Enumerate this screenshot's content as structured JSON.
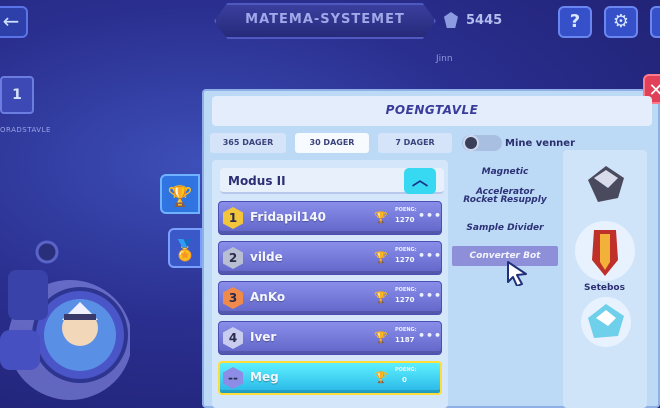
{
  "header": {
    "title": "MATEMA-SYSTEMET",
    "currency_value": "5445",
    "currency_icon": "gem-icon",
    "help_label": "?",
    "location_label": "Jinn"
  },
  "left": {
    "level_value": "1",
    "level_caption": "ORADSTAVLE"
  },
  "modal": {
    "title": "POENGTAVLE",
    "filters": [
      {
        "label": "365 DAGER",
        "active": false
      },
      {
        "label": "30 DAGER",
        "active": true
      },
      {
        "label": "7 DAGER",
        "active": false
      }
    ],
    "friends_toggle_label": "Mine venner",
    "friends_toggle_on": false,
    "mode_label": "Modus II"
  },
  "leaderboard": {
    "points_label": "POENG:",
    "rows": [
      {
        "rank": "1",
        "name": "Fridapil140",
        "points": "1270",
        "rank_color": "#f3c53a"
      },
      {
        "rank": "2",
        "name": "vilde",
        "points": "1270",
        "rank_color": "#b9bfd3"
      },
      {
        "rank": "3",
        "name": "AnKo",
        "points": "1270",
        "rank_color": "#f08a4a"
      },
      {
        "rank": "4",
        "name": "Iver",
        "points": "1187",
        "rank_color": "#c8cdf0"
      },
      {
        "rank": "--",
        "name": "Meg",
        "points": "0",
        "rank_color": "#8d8de8"
      }
    ]
  },
  "items": [
    {
      "label": "Magnetic Accelerator",
      "selected": false
    },
    {
      "label": "Rocket Resupply",
      "selected": false
    },
    {
      "label": "Sample Divider",
      "selected": false
    },
    {
      "label": "Converter Bot",
      "selected": true
    }
  ],
  "worlds": {
    "selected_label": "Setebos"
  },
  "colors": {
    "accent_cyan": "#37d9f2",
    "row_purple": "#7478dc",
    "close_red": "#e04058",
    "modal_bg": "#bcd9f6"
  }
}
